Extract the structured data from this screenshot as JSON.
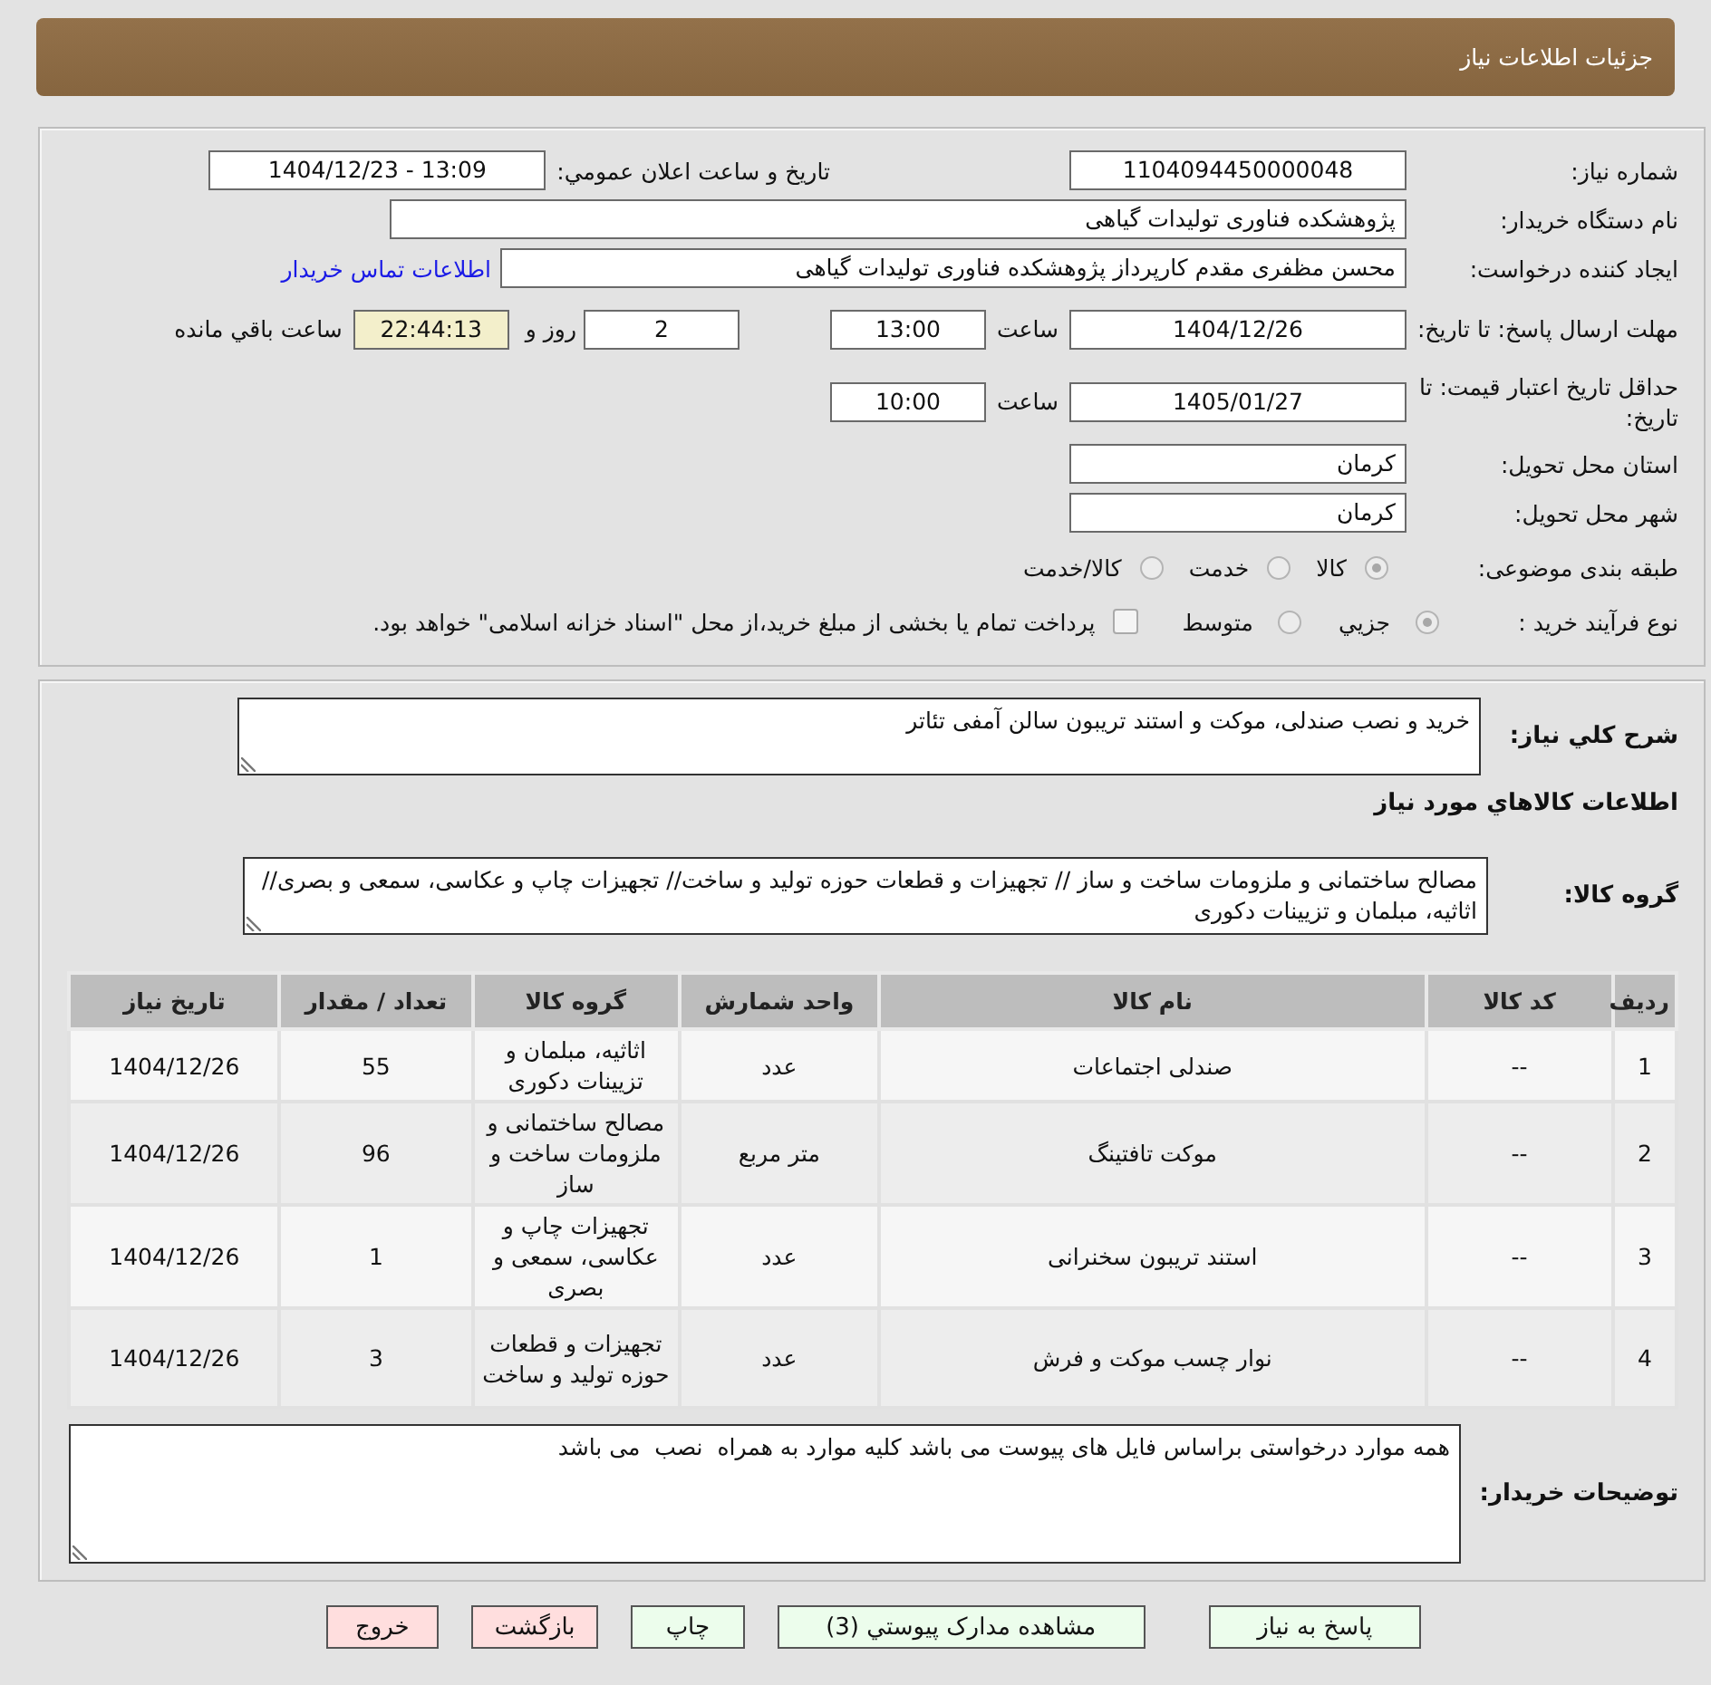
{
  "header": {
    "title": "جزئیات اطلاعات نیاز"
  },
  "details": {
    "need_number": {
      "label": "شماره نیاز:",
      "value": "1104094450000048"
    },
    "announce_datetime": {
      "label": "تاریخ و ساعت اعلان عمومي:",
      "value": "1404/12/23 - 13:09"
    },
    "buyer_org": {
      "label": "نام دستگاه خریدار:",
      "value": "پژوهشکده فناوری تولیدات گیاهی"
    },
    "requester": {
      "label": "ایجاد کننده درخواست:",
      "value": "محسن مظفری مقدم کارپرداز پژوهشکده فناوری تولیدات گیاهی",
      "link": "اطلاعات تماس خریدار"
    },
    "reply_deadline": {
      "label": "مهلت ارسال پاسخ: تا تاریخ:",
      "date": "1404/12/26",
      "time_label": "ساعت",
      "time": "13:00",
      "days": "2",
      "days_label": "روز و",
      "remaining": "22:44:13",
      "remaining_label": "ساعت باقي مانده"
    },
    "price_validity": {
      "label": "حداقل تاریخ اعتبار قیمت: تا تاریخ:",
      "date": "1405/01/27",
      "time_label": "ساعت",
      "time": "10:00"
    },
    "province": {
      "label": "استان محل تحویل:",
      "value": "کرمان"
    },
    "city": {
      "label": "شهر محل تحویل:",
      "value": "کرمان"
    },
    "subject_category": {
      "label": "طبقه بندی موضوعی:",
      "disabled": true,
      "options": [
        {
          "label": "کالا",
          "selected": true
        },
        {
          "label": "خدمت",
          "selected": false
        },
        {
          "label": "کالا/خدمت",
          "selected": false
        }
      ]
    },
    "purchase_process": {
      "label": "نوع فرآیند خرید :",
      "disabled": true,
      "options": [
        {
          "label": "جزيي",
          "selected": true
        },
        {
          "label": "متوسط",
          "selected": false
        }
      ],
      "treasury": {
        "checked": false,
        "label": "پرداخت تمام یا بخشی از مبلغ خرید،از محل \"اسناد خزانه اسلامی\" خواهد بود."
      }
    }
  },
  "need": {
    "description": {
      "label": "شرح کلي نیاز:",
      "value": "خرید و نصب صندلی، موکت و استند تریبون سالن آمفی تئاتر"
    },
    "goods_heading": "اطلاعات کالاهاي مورد نیاز",
    "goods_group": {
      "label": "گروه کالا:",
      "value": "مصالح ساختمانی و ملزومات ساخت و ساز // تجهیزات و قطعات حوزه تولید و ساخت// تجهیزات چاپ و عکاسی، سمعی و بصری// اثاثیه، مبلمان و تزیینات دکوری"
    },
    "table": {
      "columns": [
        "ردیف",
        "کد کالا",
        "نام کالا",
        "واحد شمارش",
        "گروه کالا",
        "تعداد / مقدار",
        "تاریخ نیاز"
      ],
      "rows": [
        [
          "1",
          "--",
          "صندلی اجتماعات",
          "عدد",
          "اثاثیه، مبلمان و تزیینات دکوری",
          "55",
          "1404/12/26"
        ],
        [
          "2",
          "--",
          "موکت تافتینگ",
          "متر مربع",
          "مصالح ساختمانی و ملزومات ساخت و ساز",
          "96",
          "1404/12/26"
        ],
        [
          "3",
          "--",
          "استند تریبون سخنرانی",
          "عدد",
          "تجهیزات چاپ و عکاسی، سمعی و بصری",
          "1",
          "1404/12/26"
        ],
        [
          "4",
          "--",
          "نوار چسب موکت و فرش",
          "عدد",
          "تجهیزات و قطعات حوزه تولید و ساخت",
          "3",
          "1404/12/26"
        ]
      ]
    },
    "buyer_notes": {
      "label": "توضیحات خریدار:",
      "value": "همه موارد درخواستی براساس فایل های پیوست می باشد کلیه موارد به همراه  نصب  می باشد"
    }
  },
  "buttons": [
    {
      "label": "پاسخ به نیاز",
      "kind": "proceed"
    },
    {
      "label": "مشاهده مدارک پیوستي (3)",
      "kind": "proceed"
    },
    {
      "label": "چاپ",
      "kind": "proceed"
    },
    {
      "label": "بازگشت",
      "kind": "leave"
    },
    {
      "label": "خروج",
      "kind": "leave"
    }
  ]
}
